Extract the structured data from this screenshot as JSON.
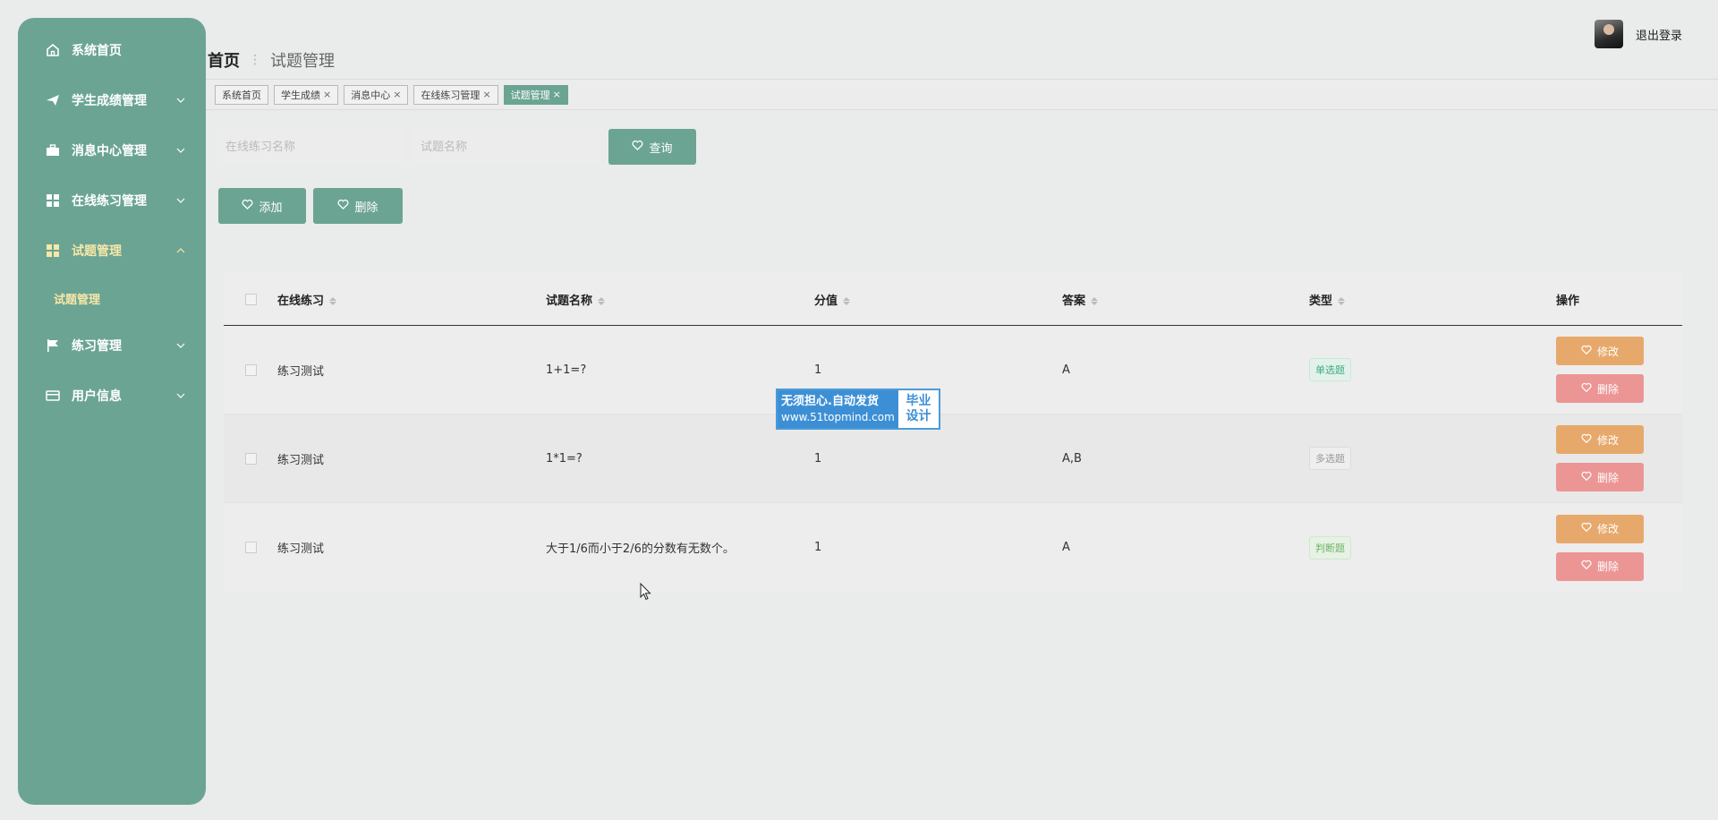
{
  "sidebar": {
    "items": [
      {
        "label": "系统首页"
      },
      {
        "label": "学生成绩管理"
      },
      {
        "label": "消息中心管理"
      },
      {
        "label": "在线练习管理"
      },
      {
        "label": "试题管理"
      },
      {
        "label": "练习管理"
      },
      {
        "label": "用户信息"
      }
    ],
    "sub_item": "试题管理"
  },
  "header": {
    "breadcrumb_home": "首页",
    "breadcrumb_current": "试题管理",
    "logout_label": "退出登录"
  },
  "tabs": [
    {
      "label": "系统首页"
    },
    {
      "label": "学生成绩"
    },
    {
      "label": "消息中心"
    },
    {
      "label": "在线练习管理"
    },
    {
      "label": "试题管理"
    }
  ],
  "search": {
    "practice_placeholder": "在线练习名称",
    "question_placeholder": "试题名称",
    "query_label": "查询"
  },
  "actions": {
    "add_label": "添加",
    "delete_label": "删除"
  },
  "table": {
    "headers": [
      "在线练习",
      "试题名称",
      "分值",
      "答案",
      "类型",
      "操作"
    ],
    "rows": [
      {
        "practice": "练习测试",
        "question": "1+1=?",
        "score": "1",
        "answer": "A",
        "type": "单选题"
      },
      {
        "practice": "练习测试",
        "question": "1*1=?",
        "score": "1",
        "answer": "A,B",
        "type": "多选题"
      },
      {
        "practice": "练习测试",
        "question": "大于1/6而小于2/6的分数有无数个。",
        "score": "1",
        "answer": "A",
        "type": "判断题"
      }
    ],
    "edit_label": "修改",
    "delete_label": "删除"
  },
  "watermark": {
    "line1": "无须担心.自动发货",
    "line2": "www.51topmind.com",
    "right_top": "毕业",
    "right_bottom": "设计"
  },
  "colors": {
    "primary": "#6ba493",
    "edit": "#e7a96b",
    "delete": "#ec9595",
    "active_nav": "#f7e7a8"
  }
}
